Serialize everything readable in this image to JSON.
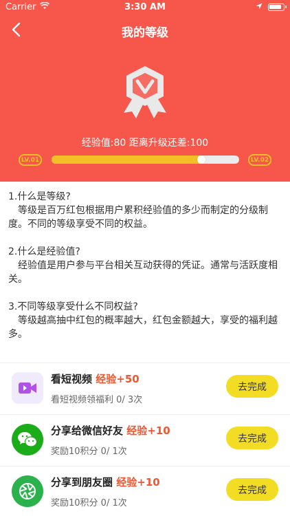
{
  "status_bar": {
    "carrier": "Carrier",
    "time": "3:30 AM"
  },
  "nav": {
    "title": "我的等级"
  },
  "level": {
    "exp_text": "经验值:80 距离升级还差:100",
    "current_label": "LV.01",
    "next_label": "LV.02",
    "progress": 0.8
  },
  "faq": [
    {
      "question": "1.什么是等级?",
      "answer": "　等级是百万红包根据用户累积经验值的多少而制定的分级制度。不同的等级享受不同的权益。"
    },
    {
      "question": "2.什么是经验值?",
      "answer": "　经验值是用户参与平台相关互动获得的凭证。通常与活跃度相关。"
    },
    {
      "question": "3.不同等级享受什么不同权益?",
      "answer": "　等级越高抽中红包的概率越大，红包金额越大，享受的福利越多。"
    }
  ],
  "tasks": [
    {
      "title": "看短视频",
      "exp": "经验+50",
      "sub": "看短视频领福利 0/ 3次",
      "button": "去完成",
      "icon": "video-icon"
    },
    {
      "title": "分享给微信好友",
      "exp": "经验+10",
      "sub": "奖励10积分 0/ 1次",
      "button": "去完成",
      "icon": "wechat-icon"
    },
    {
      "title": "分享到朋友圈",
      "exp": "经验+10",
      "sub": "奖励10积分 0/ 1次",
      "button": "去完成",
      "icon": "moments-icon"
    }
  ],
  "colors": {
    "header": "#f7574a",
    "accent_yellow": "#f2c025",
    "button_yellow": "#f2dd24",
    "exp_red": "#f2552f"
  }
}
